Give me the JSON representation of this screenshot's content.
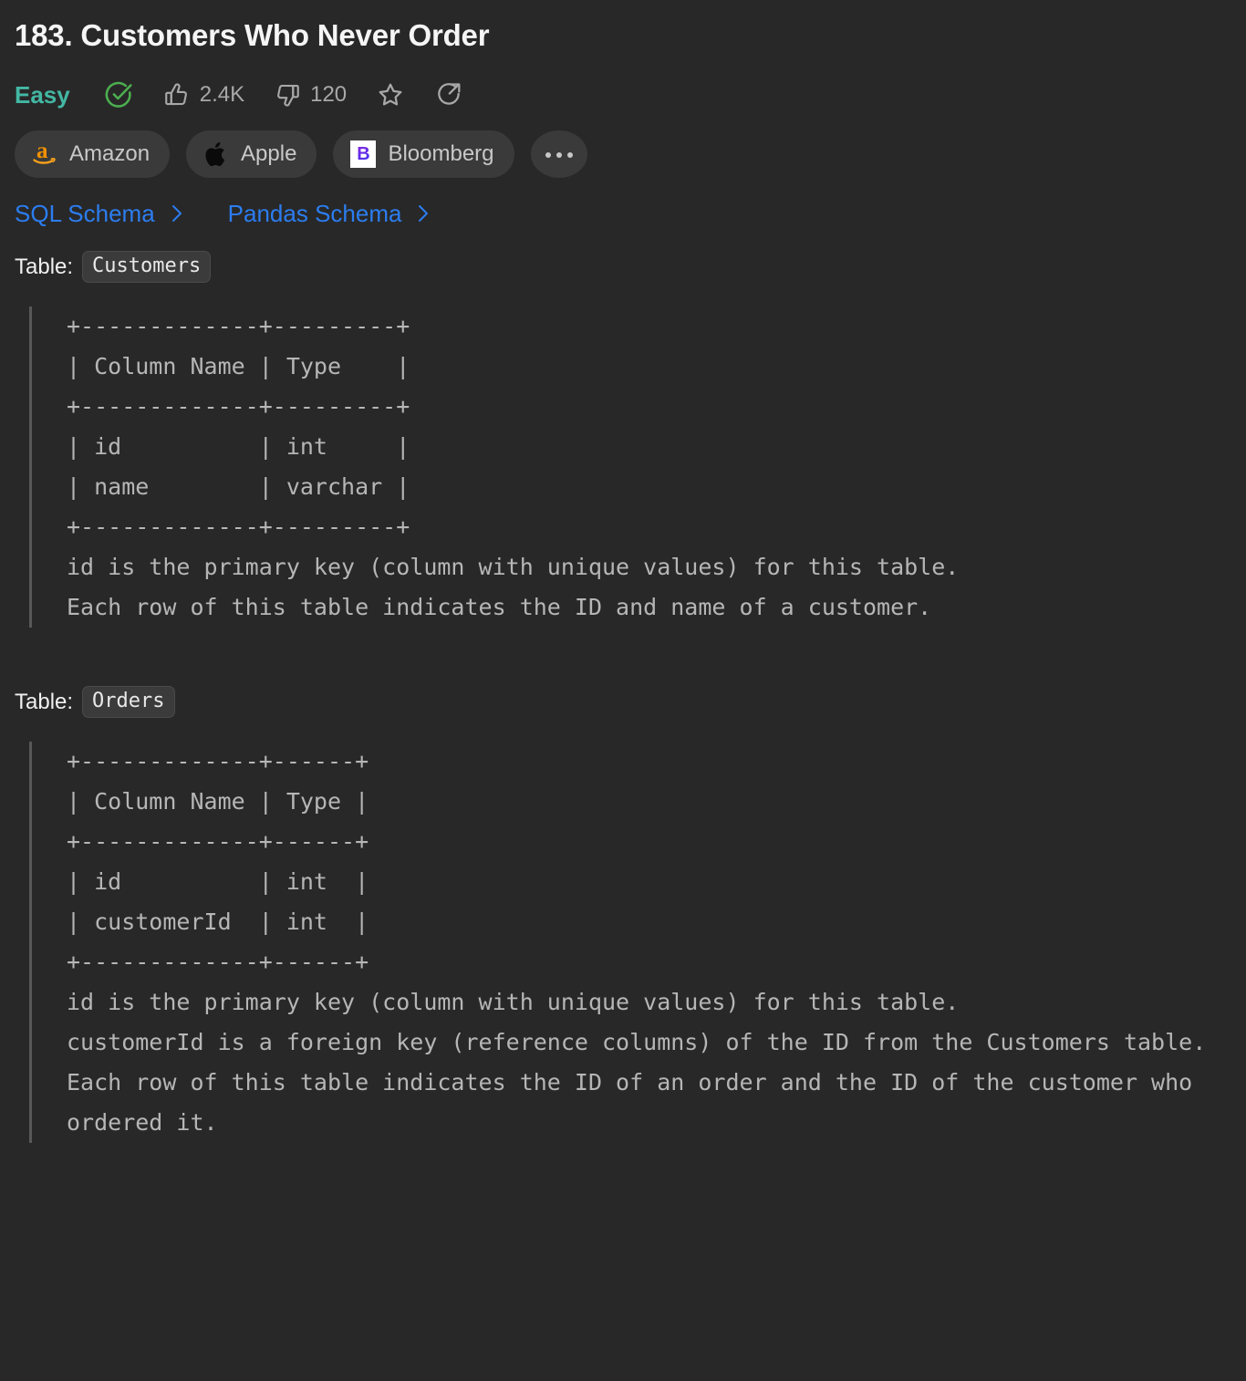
{
  "problem": {
    "title": "183. Customers Who Never Order",
    "difficulty": "Easy",
    "likes": "2.4K",
    "dislikes": "120"
  },
  "icons": {
    "solved": "check-circle-icon",
    "like": "thumbs-up-icon",
    "dislike": "thumbs-down-icon",
    "favorite": "star-icon",
    "share": "share-icon",
    "more": "ellipsis-icon"
  },
  "companies": [
    {
      "name": "Amazon",
      "logo": "amazon-logo"
    },
    {
      "name": "Apple",
      "logo": "apple-logo"
    },
    {
      "name": "Bloomberg",
      "logo": "bloomberg-logo"
    }
  ],
  "more_tags_label": "…",
  "schema_links": [
    {
      "label": "SQL Schema"
    },
    {
      "label": "Pandas Schema"
    }
  ],
  "tables": [
    {
      "heading_label": "Table:",
      "name": "Customers",
      "ascii": "+-------------+---------+\n| Column Name | Type    |\n+-------------+---------+\n| id          | int     |\n| name        | varchar |\n+-------------+---------+",
      "notes": "id is the primary key (column with unique values) for this table.\nEach row of this table indicates the ID and name of a customer."
    },
    {
      "heading_label": "Table:",
      "name": "Orders",
      "ascii": "+-------------+------+\n| Column Name | Type |\n+-------------+------+\n| id          | int  |\n| customerId  | int  |\n+-------------+------+",
      "notes": "id is the primary key (column with unique values) for this table.\ncustomerId is a foreign key (reference columns) of the ID from the Customers table.\nEach row of this table indicates the ID of an order and the ID of the customer who ordered it."
    }
  ],
  "colors": {
    "background": "#282828",
    "difficulty": "#43b8a4",
    "link": "#2c7df0",
    "solved": "#4cae4f",
    "muted": "#a8a8a8"
  }
}
